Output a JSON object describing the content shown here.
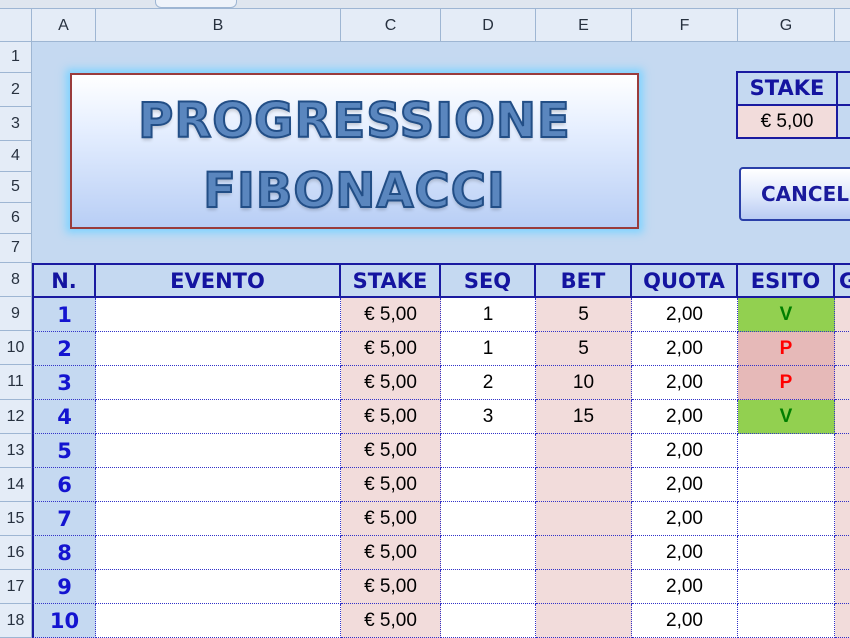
{
  "columns": [
    "A",
    "B",
    "C",
    "D",
    "E",
    "F",
    "G"
  ],
  "rows": [
    "1",
    "2",
    "3",
    "4",
    "5",
    "6",
    "7",
    "8",
    "9",
    "10",
    "11",
    "12",
    "13",
    "14",
    "15",
    "16",
    "17",
    "18"
  ],
  "banner": {
    "line1": "PROGRESSIONE",
    "line2": "FIBONACCI"
  },
  "stake_box": {
    "header": "STAKE",
    "value": "€ 5,00"
  },
  "cancel_button": {
    "label": "CANCELL"
  },
  "table": {
    "headers": [
      "N.",
      "EVENTO",
      "STAKE",
      "SEQ",
      "BET",
      "QUOTA",
      "ESITO",
      "G"
    ],
    "rows": [
      {
        "n": "1",
        "evento": "",
        "stake": "€ 5,00",
        "seq": "1",
        "bet": "5",
        "quota": "2,00",
        "esito": "V"
      },
      {
        "n": "2",
        "evento": "",
        "stake": "€ 5,00",
        "seq": "1",
        "bet": "5",
        "quota": "2,00",
        "esito": "P"
      },
      {
        "n": "3",
        "evento": "",
        "stake": "€ 5,00",
        "seq": "2",
        "bet": "10",
        "quota": "2,00",
        "esito": "P"
      },
      {
        "n": "4",
        "evento": "",
        "stake": "€ 5,00",
        "seq": "3",
        "bet": "15",
        "quota": "2,00",
        "esito": "V"
      },
      {
        "n": "5",
        "evento": "",
        "stake": "€ 5,00",
        "seq": "",
        "bet": "",
        "quota": "2,00",
        "esito": ""
      },
      {
        "n": "6",
        "evento": "",
        "stake": "€ 5,00",
        "seq": "",
        "bet": "",
        "quota": "2,00",
        "esito": ""
      },
      {
        "n": "7",
        "evento": "",
        "stake": "€ 5,00",
        "seq": "",
        "bet": "",
        "quota": "2,00",
        "esito": ""
      },
      {
        "n": "8",
        "evento": "",
        "stake": "€ 5,00",
        "seq": "",
        "bet": "",
        "quota": "2,00",
        "esito": ""
      },
      {
        "n": "9",
        "evento": "",
        "stake": "€ 5,00",
        "seq": "",
        "bet": "",
        "quota": "2,00",
        "esito": ""
      },
      {
        "n": "10",
        "evento": "",
        "stake": "€ 5,00",
        "seq": "",
        "bet": "",
        "quota": "2,00",
        "esito": ""
      }
    ]
  },
  "colors": {
    "sheet_bg": "#c5d9f1",
    "stake_pink": "#f2dcdb",
    "win_green": "#92d050",
    "lose_red": "#e6b9b8",
    "border_blue": "#1a1aa0"
  }
}
